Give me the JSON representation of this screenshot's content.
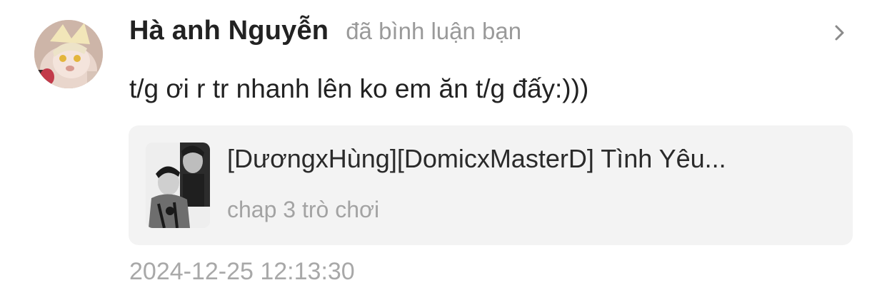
{
  "notification": {
    "username": "Hà anh Nguyễn",
    "action": "đã bình luận bạn",
    "comment": "t/g ơi r tr nhanh lên ko em ăn t/g đấy:)))",
    "story": {
      "title": "[DươngxHùng][DomicxMasterD] Tình Yêu...",
      "chapter": "chap 3 trò chơi"
    },
    "timestamp": "2024-12-25 12:13:30"
  },
  "icons": {
    "chevron": "chevron-right-icon"
  },
  "colors": {
    "username": "#222222",
    "muted": "#9a9a9a",
    "card_background": "#f3f3f3"
  }
}
